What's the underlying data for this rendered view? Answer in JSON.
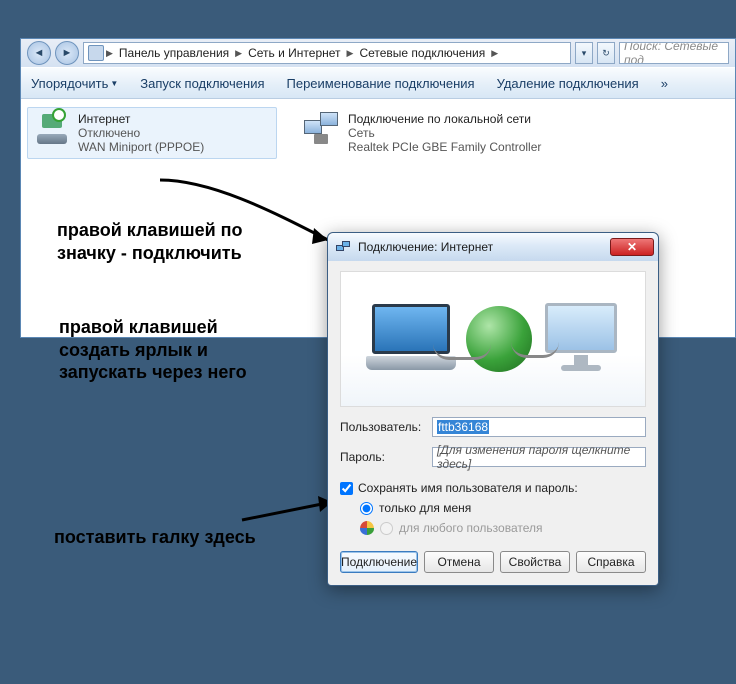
{
  "explorer": {
    "breadcrumbs": [
      "Панель управления",
      "Сеть и Интернет",
      "Сетевые подключения"
    ],
    "search_placeholder": "Поиск: Сетевые под",
    "toolbar": {
      "organize": "Упорядочить",
      "start": "Запуск подключения",
      "rename": "Переименование подключения",
      "delete": "Удаление подключения",
      "more": "»"
    },
    "connections": [
      {
        "name": "Интернет",
        "status": "Отключено",
        "device": "WAN Miniport (PPPOE)",
        "selected": true,
        "kind": "dialup"
      },
      {
        "name": "Подключение по локальной сети",
        "status": "Сеть",
        "device": "Realtek PCIe GBE Family Controller",
        "selected": false,
        "kind": "lan"
      }
    ]
  },
  "annotations": {
    "a1_line1": "правой клавишей по",
    "a1_line2": "значку - подключить",
    "a2_line1": "правой клавишей",
    "a2_line2": "создать ярлык и",
    "a2_line3": "запускать через него",
    "a3": "поставить галку здесь"
  },
  "dialog": {
    "title": "Подключение: Интернет",
    "user_label": "Пользователь:",
    "user_value": "fttb36168",
    "pass_label": "Пароль:",
    "pass_placeholder": "[Для изменения пароля щелкните здесь]",
    "save_creds": "Сохранять имя пользователя и пароль:",
    "only_me": "только для меня",
    "any_user": "для любого пользователя",
    "buttons": {
      "connect": "Подключение",
      "cancel": "Отмена",
      "props": "Свойства",
      "help": "Справка"
    }
  }
}
